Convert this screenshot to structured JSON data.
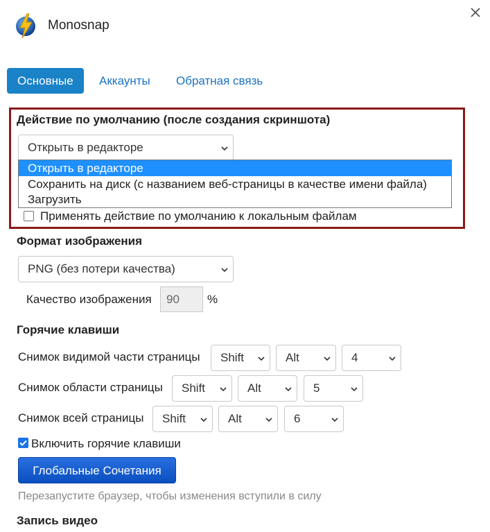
{
  "app": {
    "title": "Monosnap",
    "logo_icon": "lightning-globe-icon",
    "close_icon": "close-icon"
  },
  "tabs": [
    {
      "label": "Основные",
      "active": true
    },
    {
      "label": "Аккаунты",
      "active": false
    },
    {
      "label": "Обратная связь",
      "active": false
    }
  ],
  "default_action": {
    "heading": "Действие по умолчанию (после создания скриншота)",
    "selected": "Открыть в редакторе",
    "options": [
      "Открыть в редакторе",
      "Сохранить на диск (с названием веб-страницы в качестве имени файла)",
      "Загрузить"
    ],
    "local_files_label": "Применять действие по умолчанию к локальным файлам",
    "local_files_checked": false
  },
  "image_format": {
    "heading": "Формат изображения",
    "selected": "PNG (без потери качества)",
    "quality_label": "Качество изображения",
    "quality_value": "90",
    "quality_unit": "%"
  },
  "hotkeys": {
    "heading": "Горячие клавиши",
    "rows": [
      {
        "label": "Снимок видимой части страницы",
        "mod1": "Shift",
        "mod2": "Alt",
        "key": "4"
      },
      {
        "label": "Снимок области страницы",
        "mod1": "Shift",
        "mod2": "Alt",
        "key": "5"
      },
      {
        "label": "Снимок всей страницы",
        "mod1": "Shift",
        "mod2": "Alt",
        "key": "6"
      }
    ],
    "enable_label": "Включить горячие клавиши",
    "enable_checked": true,
    "global_button": "Глобальные Сочетания",
    "restart_note": "Перезапустите браузер, чтобы изменения вступили в силу"
  },
  "video": {
    "heading": "Запись видео"
  },
  "colors": {
    "accent": "#1a82c7",
    "highlight_border": "#8b1a1a",
    "option_selected": "#1e90ff"
  }
}
